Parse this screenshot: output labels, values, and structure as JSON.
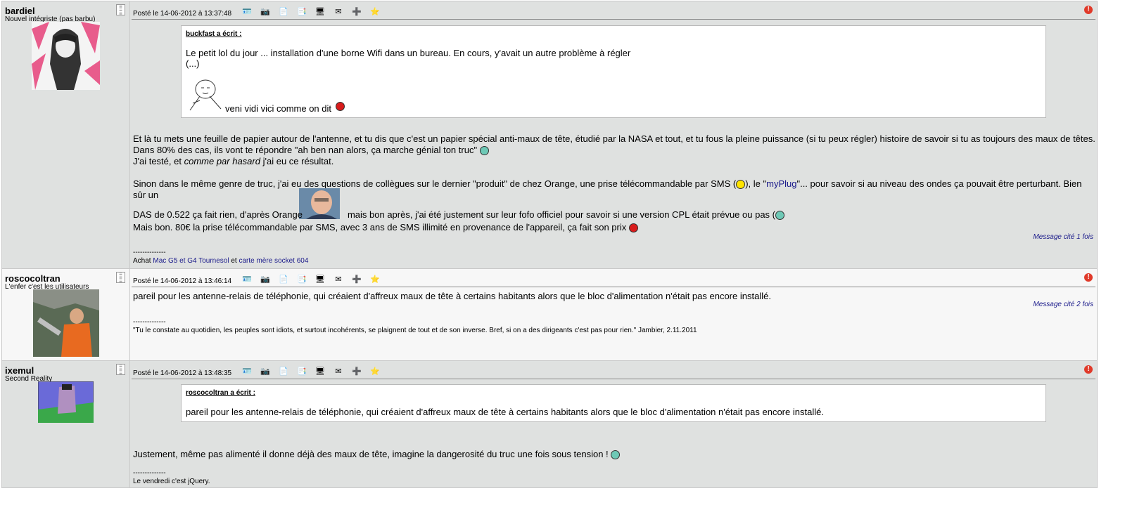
{
  "posts": [
    {
      "author": "bardiel",
      "user_title": "Nouvel intégriste (pas barbu)",
      "date": "Posté le 14-06-2012 à 13:37:48",
      "quote": {
        "header": "buckfast a écrit :",
        "line1": "Le petit lol du jour ... installation d'une borne Wifi dans un bureau. En cours, y'avait un autre problème à régler",
        "line2": "(...)",
        "line3": "veni vidi vici comme on dit"
      },
      "body": {
        "p1": "Et là tu mets une feuille de papier autour de l'antenne, et tu dis que c'est un papier spécial anti-maux de tête, étudié par la NASA et tout, et tu fous la pleine puissance (si tu peux régler) histoire de savoir si tu as toujours des maux de têtes.",
        "p2": "Dans 80% des cas, ils vont te répondre \"ah ben nan alors, ça marche génial ton truc\"",
        "p3a": "J'ai testé, et",
        "p3b": "comme par hasard",
        "p3c": "j'ai eu ce résultat.",
        "p4a": "Sinon dans le même genre de truc, j'ai eu des questions de collègues sur le dernier \"produit\" de chez Orange, une prise télécommandable par SMS (",
        "p4b": "), le \"",
        "p4link": "myPlug",
        "p4c": "\"... pour savoir si au niveau des ondes ça pouvait être perturbant. Bien sûr un",
        "p5a": "DAS de 0.522 ça fait rien, d'après Orange",
        "p5b": "mais bon après, j'ai été justement sur leur fofo officiel pour savoir si une version CPL était prévue ou pas (",
        "p6": "Mais bon. 80€ la prise télécommandable par SMS, avec 3 ans de SMS illimité en provenance de l'appareil, ça fait son prix"
      },
      "cited": "Message cité 1 fois",
      "sig_sep": "--------------",
      "sig_a": "Achat",
      "sig_link1": "Mac G5 et G4 Tournesol",
      "sig_et": "et",
      "sig_link2": "carte mère socket 604"
    },
    {
      "author": "roscocoltran",
      "user_title": "L'enfer c'est les utilisateurs",
      "date": "Posté le 14-06-2012 à 13:46:14",
      "body": "pareil pour les antenne-relais de téléphonie, qui créaient d'affreux maux de tête à certains habitants alors que le bloc d'alimentation n'était pas encore installé.",
      "cited": "Message cité 2 fois",
      "sig_sep": "--------------",
      "sig": "\"Tu le constate au quotidien, les peuples sont idiots, et surtout incohérents, se plaignent de tout et de son inverse. Bref, si on a des dirigeants c'est pas pour rien.\" Jambier, 2.11.2011"
    },
    {
      "author": "ixemul",
      "user_title": "Second Reality",
      "date": "Posté le 14-06-2012 à 13:48:35",
      "quote": {
        "header": "roscocoltran a écrit :",
        "line1": "pareil pour les antenne-relais de téléphonie, qui créaient d'affreux maux de tête à certains habitants alors que le bloc d'alimentation n'était pas encore installé."
      },
      "body": "Justement, même pas alimenté il donne déjà des maux de tête, imagine la dangerosité du truc une fois sous tension !",
      "sig_sep": "--------------",
      "sig": "Le vendredi c'est jQuery."
    }
  ],
  "icons": {
    "toolbar": [
      "profile-card-icon",
      "photos-icon",
      "quote-icon",
      "multi-quote-icon",
      "config-icon",
      "private-message-icon",
      "add-contact-icon",
      "favorite-star-icon"
    ],
    "alert": "!"
  }
}
